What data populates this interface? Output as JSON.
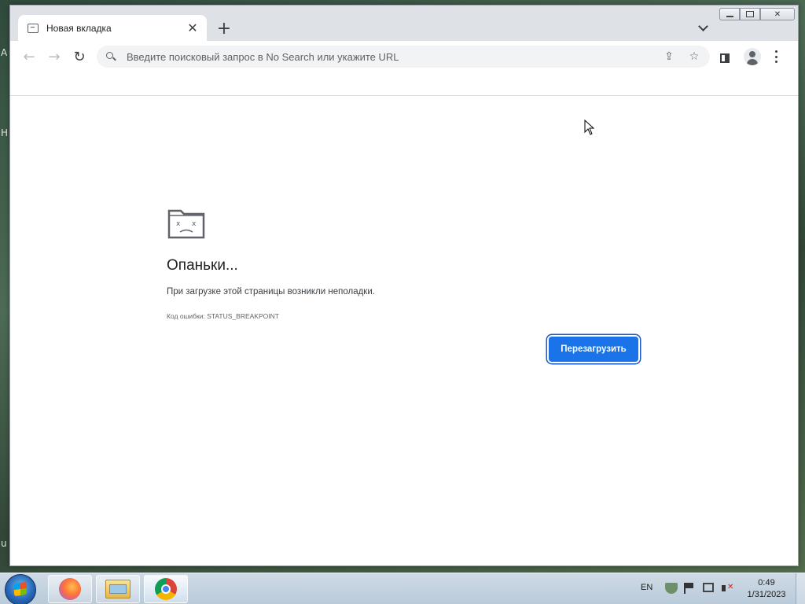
{
  "browser": {
    "tab": {
      "title": "Новая вкладка",
      "close_glyph": "✕",
      "favicon": "page-icon"
    },
    "new_tab_glyph": "+",
    "omnibox": {
      "placeholder": "Введите поисковый запрос в No Search или укажите URL",
      "value": ""
    },
    "icons": [
      "back-icon",
      "forward-icon",
      "reload-icon",
      "search-icon",
      "share-icon",
      "star-icon",
      "side-panel-icon",
      "profile-icon",
      "menu-icon"
    ]
  },
  "nav": {
    "back": "←",
    "forward": "→",
    "reload": "↻",
    "share": "⇪",
    "star": "☆"
  },
  "error_page": {
    "title": "Опаньки...",
    "description": "При загрузке этой страницы возникли неполадки.",
    "error_code": "Код ошибки: STATUS_BREAKPOINT",
    "reload_button": "Перезагрузить"
  },
  "taskbar": {
    "apps": [
      "firefox",
      "file-explorer",
      "chrome"
    ],
    "language": "EN",
    "time": "0:49",
    "date": "1/31/2023"
  },
  "desktop": {
    "edge_glyphs": [
      "A",
      "H",
      "u"
    ]
  },
  "colors": {
    "accent": "#1a73e8",
    "tabstrip": "#dee1e6",
    "page_bg": "#ffffff"
  }
}
